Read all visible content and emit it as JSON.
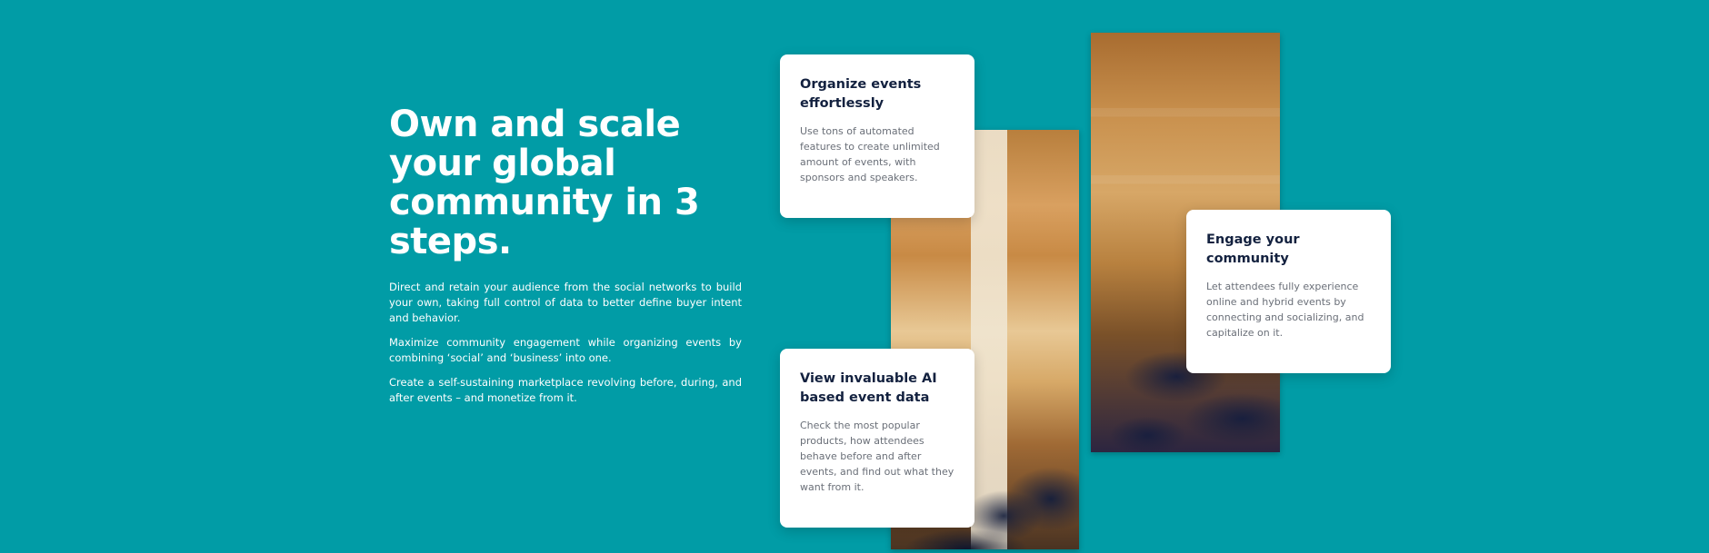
{
  "hero": {
    "title": "Own and scale your global community in 3 steps.",
    "paragraphs": [
      "Direct and retain your audience from the social networks to build your own, taking full control of data to better define buyer intent and behavior.",
      "Maximize community engagement while organizing events by combining ‘social’ and ‘business’ into one.",
      "Create a self-sustaining marketplace revolving before, during, and after events – and monetize from it."
    ]
  },
  "cards": {
    "organize": {
      "title": "Organize events effortlessly",
      "text": "Use tons of automated features to create unlimited amount of events, with sponsors and speakers."
    },
    "engage": {
      "title": "Engage your community",
      "text": "Let attendees fully experience online and hybrid events by connecting and socializing, and capitalize on it."
    },
    "ai": {
      "title": "View invaluable AI based event data",
      "text": "Check the most popular products, how attendees behave before and after events, and find out what they want from it."
    }
  },
  "images": {
    "left": "conference-speaker-photo",
    "right": "audience-raised-hand-photo"
  },
  "colors": {
    "background": "#019ca6",
    "card_title": "#13213f",
    "card_text": "#6a6f78",
    "hero_text": "#ffffff"
  }
}
